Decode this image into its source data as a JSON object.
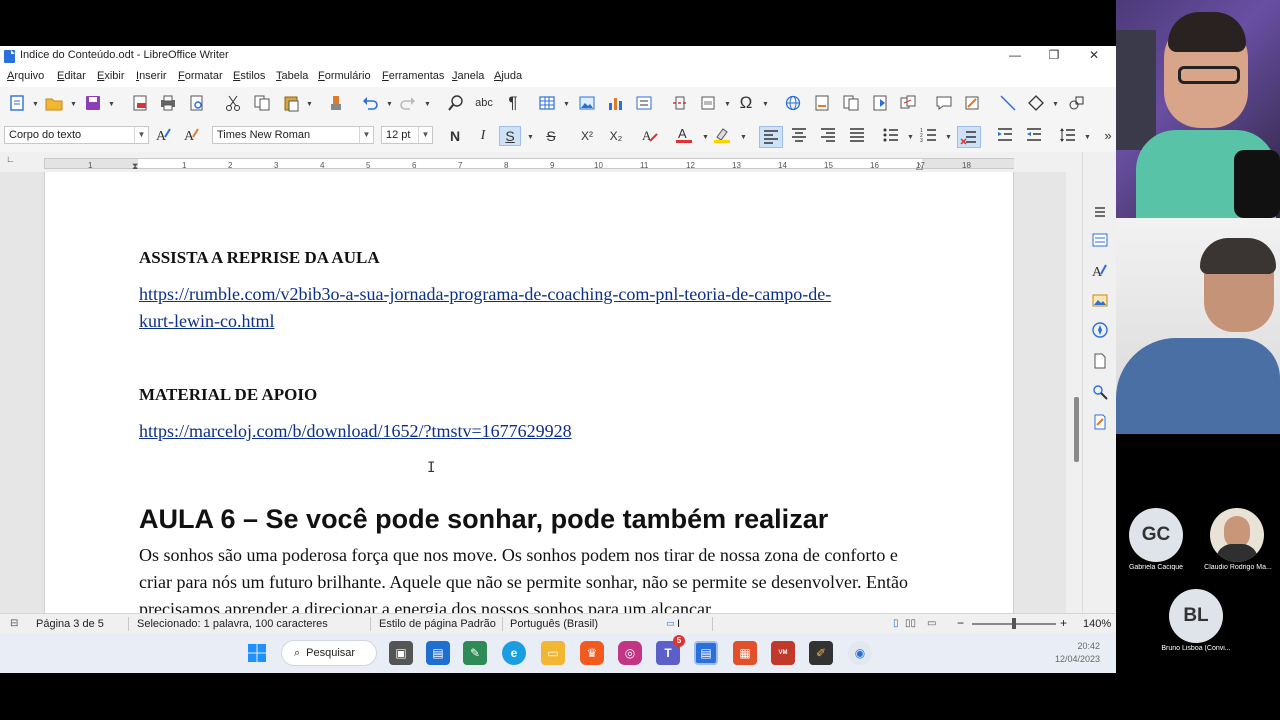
{
  "window": {
    "title": "Indice do Conteúdo.odt - LibreOffice Writer",
    "controls": [
      "—",
      "❐",
      "✕"
    ]
  },
  "menubar": {
    "items": [
      {
        "u": "A",
        "rest": "rquivo"
      },
      {
        "u": "E",
        "rest": "ditar"
      },
      {
        "u": "E",
        "rest": "xibir"
      },
      {
        "u": "I",
        "rest": "nserir"
      },
      {
        "u": "F",
        "rest": "ormatar"
      },
      {
        "u": "E",
        "rest": "stilos"
      },
      {
        "u": "T",
        "rest": "abela"
      },
      {
        "u": "F",
        "rest": "ormulário"
      },
      {
        "u": "F",
        "rest": "erramentas"
      },
      {
        "u": "J",
        "rest": "anela"
      },
      {
        "u": "A",
        "rest": "juda"
      }
    ]
  },
  "format_toolbar": {
    "paragraph_style": "Corpo do texto",
    "font_name": "Times New Roman",
    "font_size": "12 pt",
    "bold": "N",
    "italic": "I",
    "underline": "S",
    "strike": "S",
    "superscript": "X²",
    "subscript": "X₂"
  },
  "ruler": {
    "ticks": [
      "1",
      "1",
      "2",
      "3",
      "4",
      "5",
      "6",
      "7",
      "8",
      "9",
      "10",
      "11",
      "12",
      "13",
      "14",
      "15",
      "16",
      "17",
      "18"
    ]
  },
  "document": {
    "heading1": "ASSISTA A REPRISE DA AULA",
    "link1_line1": "https://rumble.com/v2bib3o-a-sua-jornada-programa-de-coaching-com-pnl-teoria-de-campo-de-",
    "link1_line2": "kurt-lewin-co.html",
    "heading2": "MATERIAL DE APOIO",
    "link2": "https://marceloj.com/b/download/1652/?tmstv=1677629928",
    "lesson_title": "AULA 6 – Se você pode sonhar, pode também realizar",
    "paragraph": "Os sonhos são uma poderosa força que nos move. Os sonhos podem nos tirar de nossa zona de conforto e criar para nós um futuro brilhante. Aquele que não se permite sonhar, não se permite se desenvolver. Então precisamos aprender a direcionar a energia dos nossos sonhos para um alcançar"
  },
  "statusbar": {
    "page": "Página 3 de 5",
    "selection": "Selecionado: 1 palavra, 100 caracteres",
    "page_style": "Estilo de página Padrão",
    "language": "Português (Brasil)",
    "insert_mode": "I",
    "zoom": "140%"
  },
  "taskbar": {
    "search_label": "Pesquisar",
    "teams_badge": "5",
    "time": "20:42",
    "date": "12/04/2023"
  },
  "participants": [
    {
      "initials": "GC",
      "name": "Gabriela Cacique"
    },
    {
      "initials": "",
      "name": "Claudio Rodrigo Ma..."
    },
    {
      "initials": "BL",
      "name": "Bruno Lisboa (Convi..."
    }
  ],
  "colors": {
    "link": "#0b2f8a",
    "accent": "#2a6fdb",
    "taskbar": "#e9eef6"
  }
}
